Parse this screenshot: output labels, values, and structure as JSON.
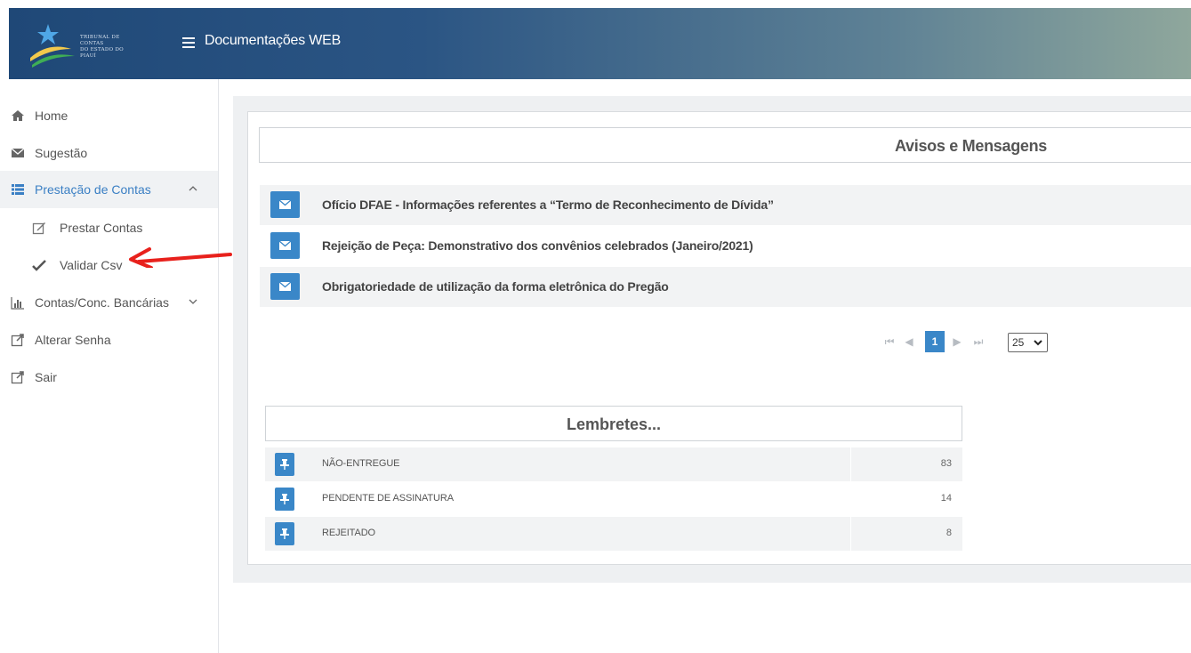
{
  "header": {
    "logo_text_line1": "TRIBUNAL DE CONTAS",
    "logo_text_line2": "DO ESTADO DO PIAUÍ",
    "app_title": "Documentações WEB"
  },
  "sidebar": {
    "items": [
      {
        "label": "Home",
        "icon": "home-icon"
      },
      {
        "label": "Sugestão",
        "icon": "envelope-icon"
      },
      {
        "label": "Prestação de Contas",
        "icon": "list-icon",
        "expanded": true,
        "active": true
      },
      {
        "label": "Prestar Contas",
        "icon": "edit-icon",
        "sub": true
      },
      {
        "label": "Validar Csv",
        "icon": "check-icon",
        "sub": true
      },
      {
        "label": "Contas/Conc. Bancárias",
        "icon": "bar-chart-icon",
        "expanded": false
      },
      {
        "label": "Alterar Senha",
        "icon": "external-link-icon"
      },
      {
        "label": "Sair",
        "icon": "external-link-icon"
      }
    ]
  },
  "avisos": {
    "title": "Avisos e Mensagens",
    "items": [
      "Ofício DFAE - Informações referentes a “Termo de Reconhecimento de Dívida”",
      "Rejeição de Peça: Demonstrativo dos convênios celebrados (Janeiro/2021)",
      "Obrigatoriedade de utilização da forma eletrônica do Pregão"
    ]
  },
  "pagination": {
    "current_page": "1",
    "page_size": "25"
  },
  "lembretes": {
    "title": "Lembretes...",
    "items": [
      {
        "label": "NÃO-ENTREGUE",
        "count": "83"
      },
      {
        "label": "PENDENTE DE ASSINATURA",
        "count": "14"
      },
      {
        "label": "REJEITADO",
        "count": "8"
      }
    ]
  },
  "colors": {
    "accent": "#3a87c8",
    "annotation_arrow": "#e8211c",
    "active_menu_text": "#3a7fc4"
  }
}
